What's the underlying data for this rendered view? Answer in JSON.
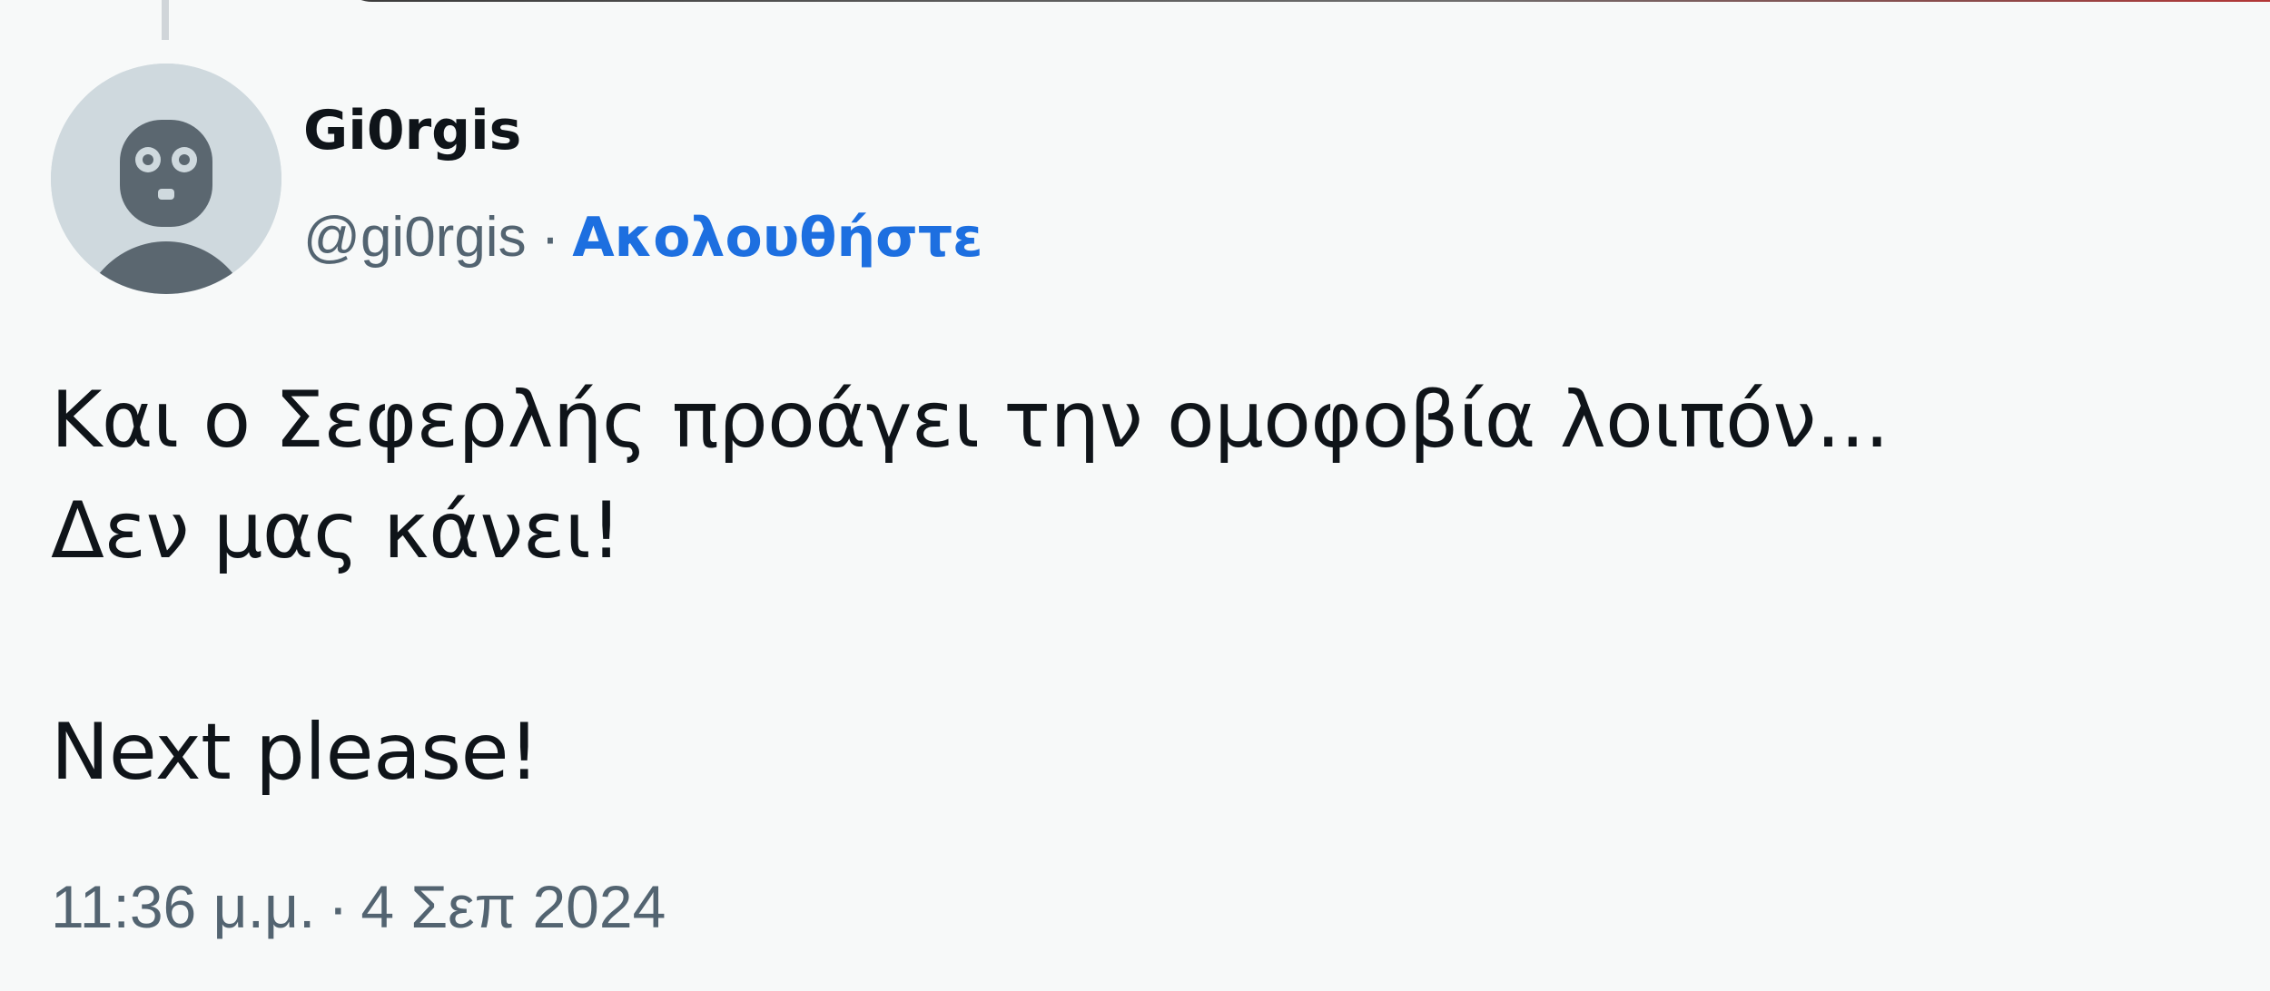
{
  "tweet": {
    "author": {
      "display_name": "Gi0rgis",
      "handle": "@gi0rgis",
      "separator": "·",
      "follow_label": "Ακολουθήστε",
      "avatar_icon": "default-avatar-icon"
    },
    "text_lines": [
      "Και ο Σεφερλής προάγει την ομοφοβία λοιπόν...",
      "Δεν μας κάνει!",
      "",
      "Next please!"
    ],
    "time": "11:36 μ.μ.",
    "meta_separator": "·",
    "date": "4 Σεπ 2024"
  },
  "colors": {
    "background": "#f7f9f9",
    "text": "#0f1419",
    "secondary_text": "#536471",
    "link": "#1d6fe0",
    "avatar_bg": "#cfd9de"
  }
}
